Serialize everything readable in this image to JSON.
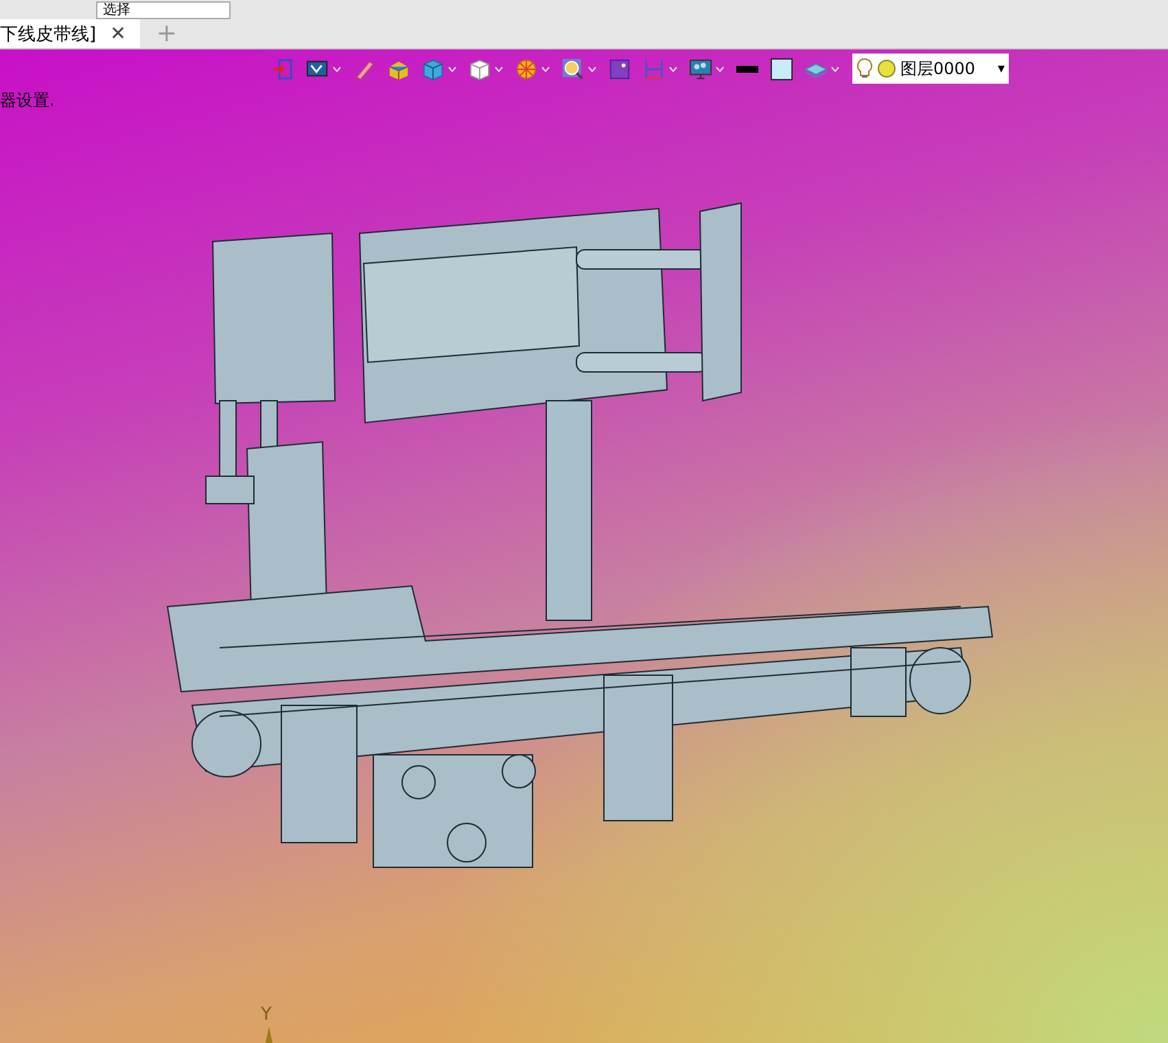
{
  "toolbar": {
    "select_field": {
      "value": "选择"
    }
  },
  "tabs": [
    {
      "label": "下线皮带线]",
      "selected": true,
      "close": "✕"
    }
  ],
  "new_tab": "+",
  "viewport": {
    "status_text": "器设置.",
    "view_toolbar": {
      "buttons": [
        {
          "kind": "exit",
          "dropdown": false
        },
        {
          "kind": "display",
          "dropdown": true
        },
        {
          "kind": "pencil",
          "dropdown": false
        },
        {
          "kind": "colorbox",
          "dropdown": false
        },
        {
          "kind": "shaded",
          "dropdown": true
        },
        {
          "kind": "cube",
          "dropdown": true
        },
        {
          "kind": "wheel",
          "dropdown": true
        },
        {
          "kind": "zoom",
          "dropdown": true
        },
        {
          "kind": "frame",
          "dropdown": false
        },
        {
          "kind": "dimension",
          "dropdown": true
        },
        {
          "kind": "monitor",
          "dropdown": true
        },
        {
          "kind": "line",
          "dropdown": false
        },
        {
          "kind": "swatch",
          "dropdown": false
        },
        {
          "kind": "layer",
          "dropdown": true
        }
      ],
      "layer": {
        "value": "图层0000",
        "caret": "▾"
      }
    },
    "axis_label": "Y"
  }
}
